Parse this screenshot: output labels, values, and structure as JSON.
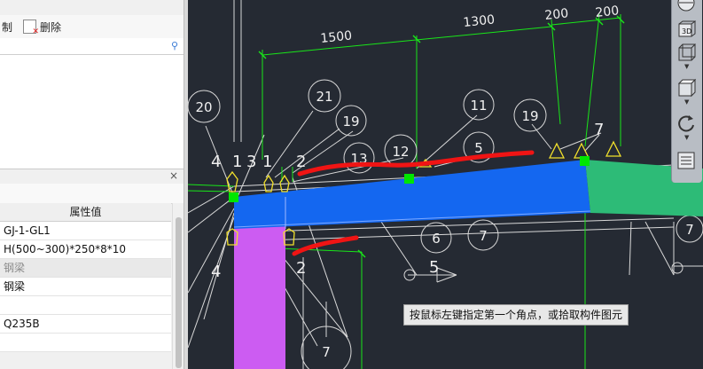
{
  "toolbar": {
    "partial_label": "制",
    "delete_label": "删除"
  },
  "properties": {
    "column_header": "属性值",
    "rows": [
      {
        "value": "GJ-1-GL1",
        "category": false
      },
      {
        "value": "H(500~300)*250*8*10",
        "category": false
      },
      {
        "value": "钢梁",
        "category": true
      },
      {
        "value": "钢梁",
        "category": false
      },
      {
        "value": "",
        "category": false
      },
      {
        "value": "Q235B",
        "category": false
      },
      {
        "value": "",
        "category": false
      }
    ]
  },
  "cad": {
    "dimensions": [
      "1500",
      "1300",
      "200",
      "200"
    ],
    "bubbles": [
      "20",
      "21",
      "19",
      "11",
      "19",
      "12",
      "5",
      "13",
      "7",
      "6",
      "7",
      "7",
      "1"
    ],
    "labels": [
      "4",
      "1",
      "3",
      "1",
      "2",
      "4",
      "2",
      "5",
      "7"
    ],
    "status_tip": "按鼠标左键指定第一个角点，或拾取构件图元",
    "colors": {
      "background": "#252a33",
      "lines": "#d8d8d8",
      "dimension": "#19e619",
      "beam_blue": "#1467f0",
      "beam_green": "#2dbb77",
      "column_purple": "#cc5cf2",
      "markup_red": "#f01414",
      "grip": "#00e600",
      "anchor_yellow": "#f1e02c"
    }
  },
  "view_tools": {
    "icons": [
      "orbit-sphere-icon",
      "3d-view-icon",
      "wireframe-box-icon",
      "solid-box-icon",
      "rotate-icon",
      "layer-list-icon"
    ],
    "view_3d_label": "3D"
  }
}
